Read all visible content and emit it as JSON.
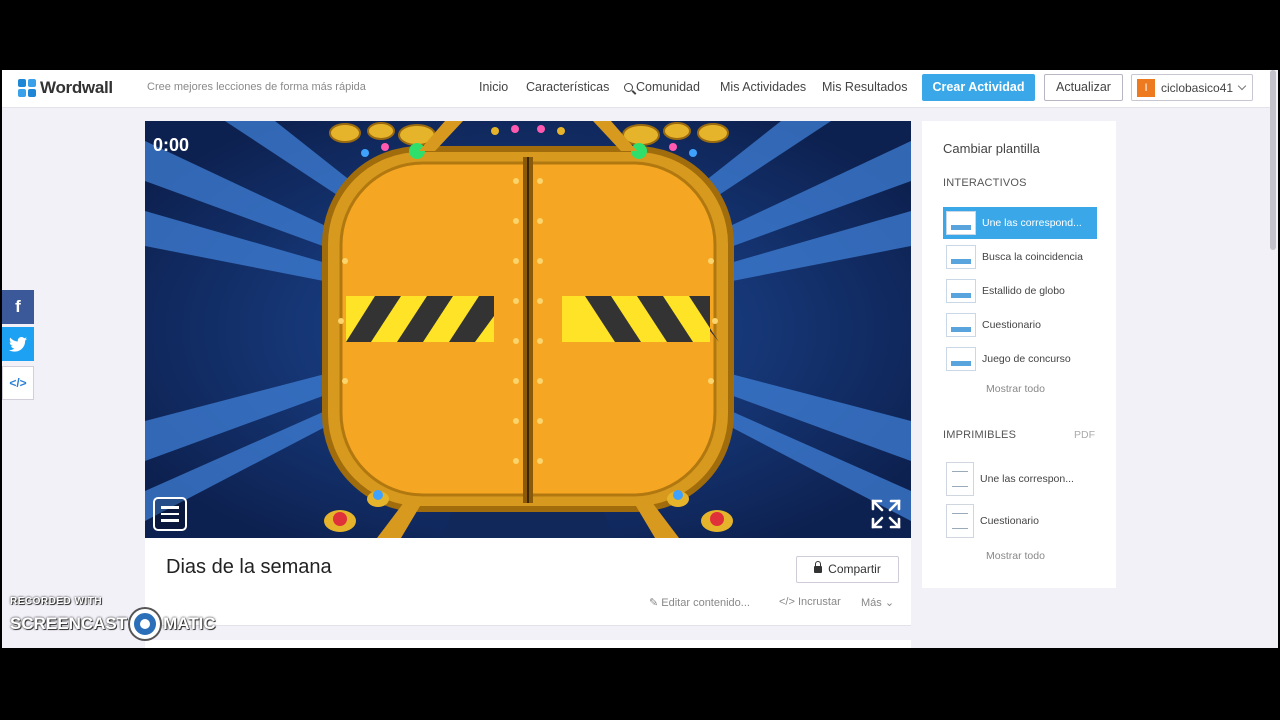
{
  "header": {
    "logo_text": "Wordwall",
    "tagline": "Cree mejores lecciones de forma más rápida",
    "nav": [
      "Inicio",
      "Características",
      "Comunidad",
      "Mis Actividades",
      "Mis Resultados"
    ],
    "create_label": "Crear Actividad",
    "update_label": "Actualizar",
    "user_initial": "I",
    "username": "ciclobasico41"
  },
  "social": {
    "facebook": "f",
    "twitter": "t",
    "embed": "</>"
  },
  "game": {
    "timer": "0:00"
  },
  "activity": {
    "title": "Dias de la semana",
    "share_label": "Compartir",
    "edit_label": "Editar contenido...",
    "embed_label": "Incrustar",
    "more_label": "Más"
  },
  "panel": {
    "title": "Cambiar plantilla",
    "interactive_heading": "INTERACTIVOS",
    "interactive": [
      "Une las correspond...",
      "Busca la coincidencia",
      "Estallido de globo",
      "Cuestionario",
      "Juego de concurso"
    ],
    "show_all_1": "Mostrar todo",
    "printable_heading": "IMPRIMIBLES",
    "pdf_label": "PDF",
    "printables": [
      "Une las correspon...",
      "Cuestionario"
    ],
    "show_all_2": "Mostrar todo"
  },
  "watermark": {
    "line1": "RECORDED WITH",
    "line2a": "SCREENCAST",
    "line2b": "MATIC"
  },
  "colors": {
    "accent": "#3aa8e8",
    "gold": "#f5a623",
    "game_bg": "#14295a"
  }
}
